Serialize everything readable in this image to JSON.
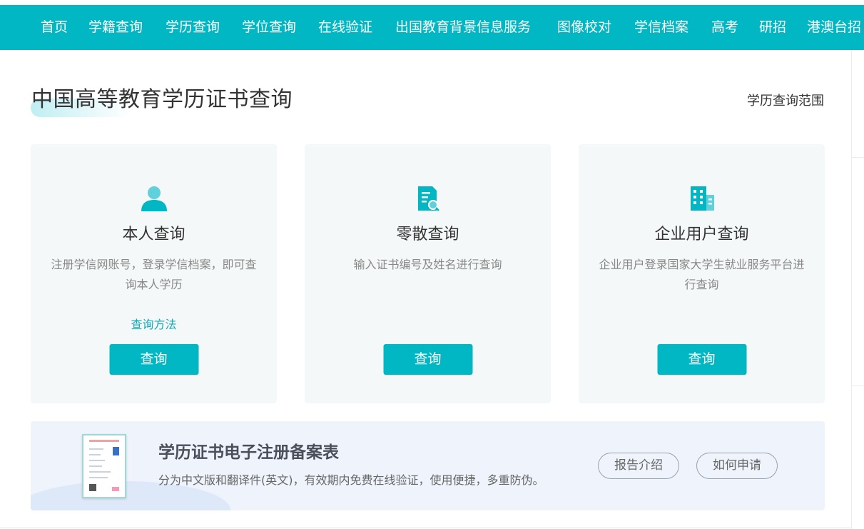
{
  "nav": {
    "items": [
      {
        "label": "首页"
      },
      {
        "label": "学籍查询"
      },
      {
        "label": "学历查询"
      },
      {
        "label": "学位查询"
      },
      {
        "label": "在线验证"
      },
      {
        "label": "出国教育背景信息服务"
      },
      {
        "label": "图像校对"
      },
      {
        "label": "学信档案"
      },
      {
        "label": "高考"
      },
      {
        "label": "研招"
      },
      {
        "label": "港澳台招"
      }
    ]
  },
  "header": {
    "title": "中国高等教育学历证书查询",
    "range_link": "学历查询范围"
  },
  "cards": [
    {
      "icon": "person-icon",
      "title": "本人查询",
      "desc": "注册学信网账号，登录学信档案，即可查询本人学历",
      "link": "查询方法",
      "button": "查询"
    },
    {
      "icon": "document-search-icon",
      "title": "零散查询",
      "desc": "输入证书编号及姓名进行查询",
      "link": "",
      "button": "查询"
    },
    {
      "icon": "building-icon",
      "title": "企业用户查询",
      "desc": "企业用户登录国家大学生就业服务平台进行查询",
      "link": "",
      "button": "查询"
    }
  ],
  "banner": {
    "title": "学历证书电子注册备案表",
    "desc": "分为中文版和翻译件(英文)，有效期内免费在线验证，使用便捷，多重防伪。",
    "report_button": "报告介绍",
    "apply_button": "如何申请"
  },
  "colors": {
    "accent": "#00b7c3",
    "link": "#13aab8",
    "card_bg": "#f5f8f9",
    "banner_bg": "#eef3fc"
  }
}
